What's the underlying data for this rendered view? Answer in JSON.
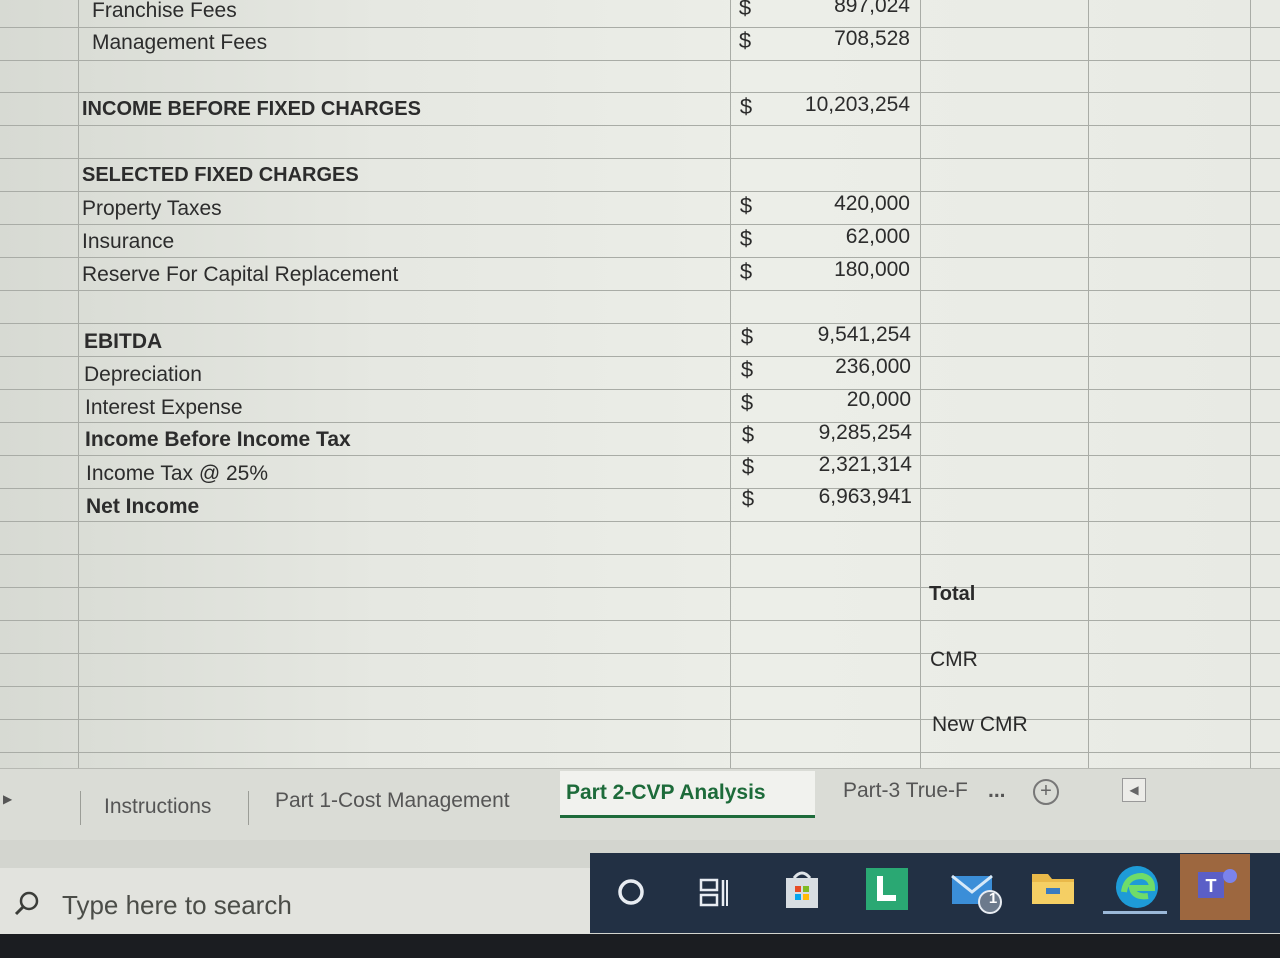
{
  "sheet": {
    "rows": [
      {
        "label": "Franchise Fees",
        "dollar": "$",
        "value": "897,024",
        "bold": false
      },
      {
        "label": "Management Fees",
        "dollar": "$",
        "value": "708,528",
        "bold": false
      },
      {
        "label": "INCOME BEFORE FIXED CHARGES",
        "dollar": "$",
        "value": "10,203,254",
        "bold": true
      },
      {
        "label": "SELECTED FIXED CHARGES",
        "dollar": "",
        "value": "",
        "bold": true
      },
      {
        "label": "Property Taxes",
        "dollar": "$",
        "value": "420,000",
        "bold": false
      },
      {
        "label": "Insurance",
        "dollar": "$",
        "value": "62,000",
        "bold": false
      },
      {
        "label": "Reserve For Capital Replacement",
        "dollar": "$",
        "value": "180,000",
        "bold": false
      },
      {
        "label": "EBITDA",
        "dollar": "$",
        "value": "9,541,254",
        "bold": true
      },
      {
        "label": "Depreciation",
        "dollar": "$",
        "value": "236,000",
        "bold": false
      },
      {
        "label": "Interest Expense",
        "dollar": "$",
        "value": "20,000",
        "bold": false
      },
      {
        "label": "Income Before Income Tax",
        "dollar": "$",
        "value": "9,285,254",
        "bold": true
      },
      {
        "label": "Income Tax @ 25%",
        "dollar": "$",
        "value": "2,321,314",
        "bold": false
      },
      {
        "label": "Net Income",
        "dollar": "$",
        "value": "6,963,941",
        "bold": true
      }
    ],
    "side_notes": [
      "Total",
      "CMR",
      "New CMR"
    ]
  },
  "tabs": [
    {
      "label": "Instructions",
      "active": false
    },
    {
      "label": "Part 1-Cost Management",
      "active": false
    },
    {
      "label": "Part 2-CVP Analysis",
      "active": true
    },
    {
      "label": "Part-3 True-F",
      "active": false
    }
  ],
  "tab_overflow": "...",
  "add_sheet_symbol": "+",
  "taskbar": {
    "search_placeholder": "Type here to search",
    "icons": [
      "cortana-icon",
      "task-view-icon",
      "store-icon",
      "l-app-icon",
      "mail-icon",
      "file-explorer-icon",
      "edge-icon",
      "teams-icon"
    ],
    "mail_badge": "1"
  },
  "colors": {
    "active_tab": "#1d6b3a",
    "taskbar": "#223044",
    "grid": "#a9aca6"
  }
}
